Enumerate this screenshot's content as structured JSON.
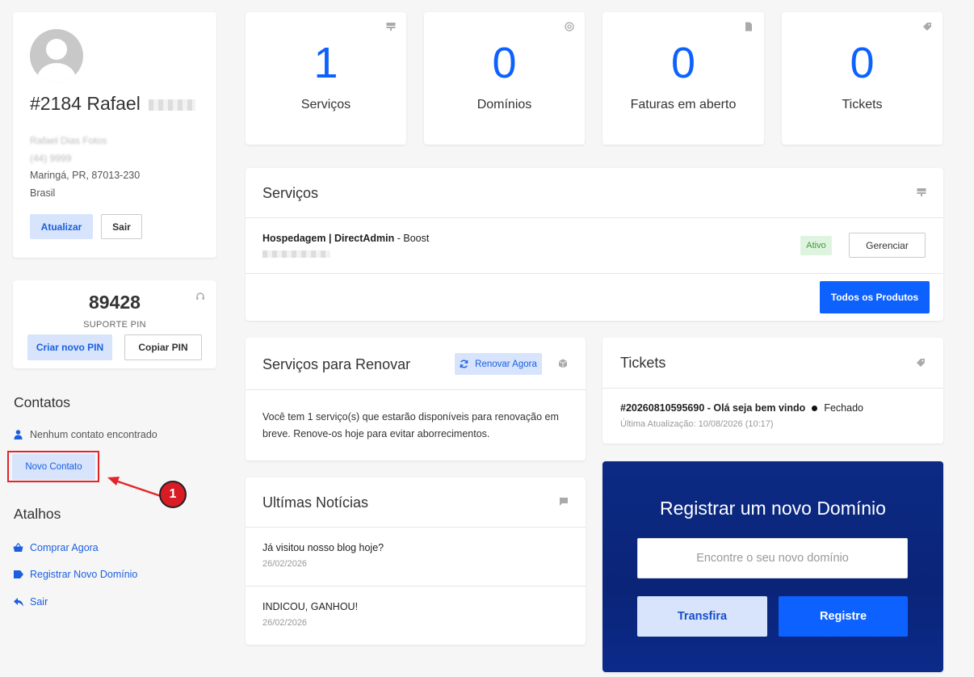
{
  "profile": {
    "name": "#2184 Rafael",
    "company_line": "Rafael Dias Fotos",
    "phone_line": "(44) 9999",
    "city_line": "Maringá, PR, 87013-230",
    "country": "Brasil",
    "update_button": "Atualizar",
    "logout_button": "Sair"
  },
  "pin": {
    "number": "89428",
    "label": "SUPORTE PIN",
    "new_pin_button": "Criar novo PIN",
    "copy_pin_button": "Copiar PIN"
  },
  "contacts": {
    "title": "Contatos",
    "empty_text": "Nenhum contato encontrado",
    "new_contact_button": "Novo Contato"
  },
  "shortcuts": {
    "title": "Atalhos",
    "items": [
      {
        "label": "Comprar Agora",
        "icon": "basket-icon"
      },
      {
        "label": "Registrar Novo Domínio",
        "icon": "tag-icon"
      },
      {
        "label": "Sair",
        "icon": "arrow-left-icon"
      }
    ]
  },
  "stats": [
    {
      "value": "1",
      "label": "Serviços",
      "icon": "server-icon"
    },
    {
      "value": "0",
      "label": "Domínios",
      "icon": "at-icon"
    },
    {
      "value": "0",
      "label": "Faturas em aberto",
      "icon": "file-icon"
    },
    {
      "value": "0",
      "label": "Tickets",
      "icon": "tag-icon"
    }
  ],
  "services": {
    "title": "Serviços",
    "item": {
      "product_bold_1": "Hospedagem",
      "separator": " | ",
      "product_bold_2": "DirectAdmin",
      "product_suffix": " - Boost",
      "status": "Ativo",
      "manage_button": "Gerenciar"
    },
    "all_products_button": "Todos os Produtos"
  },
  "renew": {
    "title": "Serviços para Renovar",
    "renew_button": "Renovar Agora",
    "body": "Você tem 1 serviço(s) que estarão disponíveis para renovação em breve. Renove-os hoje para evitar aborrecimentos."
  },
  "tickets": {
    "title": "Tickets",
    "item": {
      "subject": "#20260810595690 - Olá seja bem vindo",
      "status": "Fechado",
      "updated": "Última Atualização: 10/08/2026 (10:17)"
    }
  },
  "news": {
    "title": "Ultímas Notícias",
    "items": [
      {
        "title": "Já visitou nosso blog hoje?",
        "date": "26/02/2026"
      },
      {
        "title": "INDICOU, GANHOU!",
        "date": "26/02/2026"
      }
    ]
  },
  "domain": {
    "title": "Registrar um novo Domínio",
    "placeholder": "Encontre o seu novo domínio",
    "transfer_button": "Transfira",
    "register_button": "Registre"
  },
  "annotation": {
    "badge": "1"
  },
  "colors": {
    "accent": "#0d62ff",
    "domain_bg": "#0a2478",
    "annotation": "#e3242b"
  }
}
